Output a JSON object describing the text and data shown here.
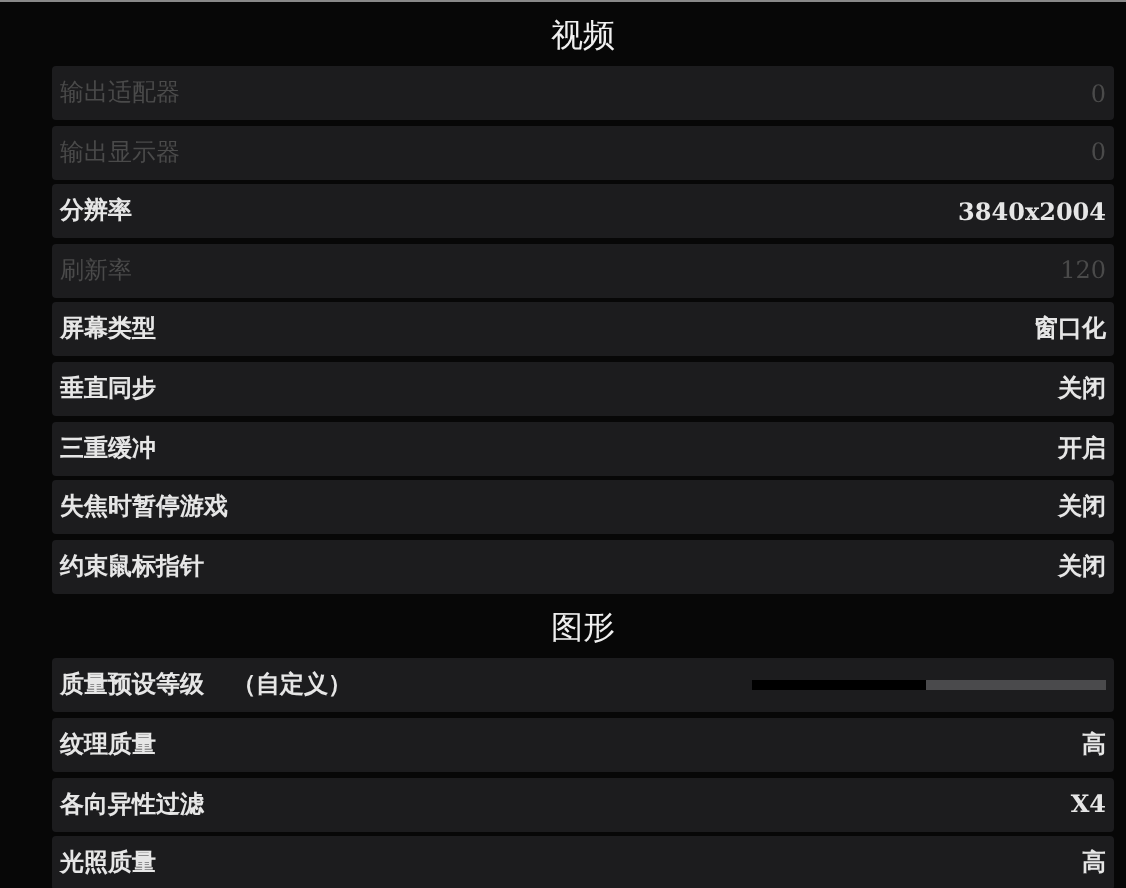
{
  "sections": [
    {
      "title": "视频",
      "items": [
        {
          "kind": "value",
          "label": "输出适配器",
          "value": "0",
          "disabled": true
        },
        {
          "kind": "value",
          "label": "输出显示器",
          "value": "0",
          "disabled": true
        },
        {
          "kind": "value",
          "label": "分辨率",
          "value": "3840x2004",
          "disabled": false
        },
        {
          "kind": "value",
          "label": "刷新率",
          "value": "120",
          "disabled": true
        },
        {
          "kind": "value",
          "label": "屏幕类型",
          "value": "窗口化",
          "disabled": false
        },
        {
          "kind": "value",
          "label": "垂直同步",
          "value": "关闭",
          "disabled": false
        },
        {
          "kind": "value",
          "label": "三重缓冲",
          "value": "开启",
          "disabled": false
        },
        {
          "kind": "value",
          "label": "失焦时暂停游戏",
          "value": "关闭",
          "disabled": false
        },
        {
          "kind": "value",
          "label": "约束鼠标指针",
          "value": "关闭",
          "disabled": false
        }
      ]
    },
    {
      "title": "图形",
      "items": [
        {
          "kind": "slider",
          "label": "质量预设等级",
          "note": "（自定义）",
          "level": 0.49,
          "disabled": false
        },
        {
          "kind": "value",
          "label": "纹理质量",
          "value": "高",
          "disabled": false
        },
        {
          "kind": "value",
          "label": "各向异性过滤",
          "value": "X4",
          "disabled": false
        },
        {
          "kind": "value",
          "label": "光照质量",
          "value": "高",
          "disabled": false
        }
      ]
    }
  ]
}
